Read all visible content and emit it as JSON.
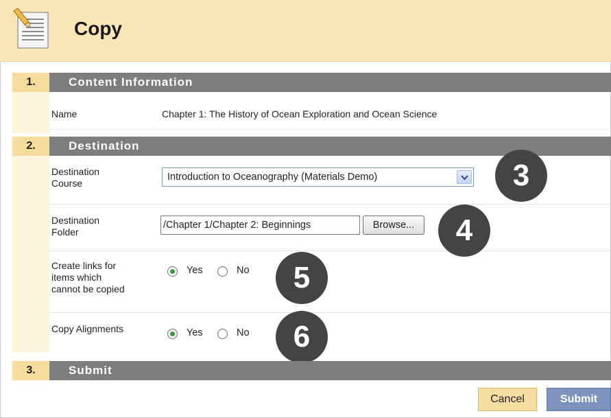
{
  "page": {
    "title": "Copy",
    "icon": "document-edit-icon"
  },
  "steps": [
    {
      "number": "1.",
      "title": "Content Information"
    },
    {
      "number": "2.",
      "title": "Destination"
    },
    {
      "number": "3.",
      "title": "Submit"
    }
  ],
  "content_info": {
    "name_label": "Name",
    "name_value": "Chapter 1: The History of Ocean Exploration and Ocean Science"
  },
  "destination": {
    "course_label_line1": "Destination",
    "course_label_line2": "Course",
    "course_selected": "Introduction to Oceanography (Materials Demo)",
    "folder_label_line1": "Destination",
    "folder_label_line2": "Folder",
    "folder_value": "/Chapter 1/Chapter 2: Beginnings",
    "browse_label": "Browse...",
    "create_links_line1": "Create links for",
    "create_links_line2": "items which",
    "create_links_line3": "cannot be copied",
    "create_links_yes": "Yes",
    "create_links_no": "No",
    "create_links_selected": "Yes",
    "alignments_label": "Copy Alignments",
    "alignments_yes": "Yes",
    "alignments_no": "No",
    "alignments_selected": "Yes"
  },
  "callouts": [
    "3",
    "4",
    "5",
    "6"
  ],
  "actions": {
    "cancel_label": "Cancel",
    "submit_label": "Submit"
  },
  "colors": {
    "header_bg": "#fbe6b8",
    "step_bar": "#7d7d7d",
    "step_number_bg": "#f5dc9c",
    "submit_bg": "#7d93bd",
    "radio_checked": "#3a9b3a"
  }
}
